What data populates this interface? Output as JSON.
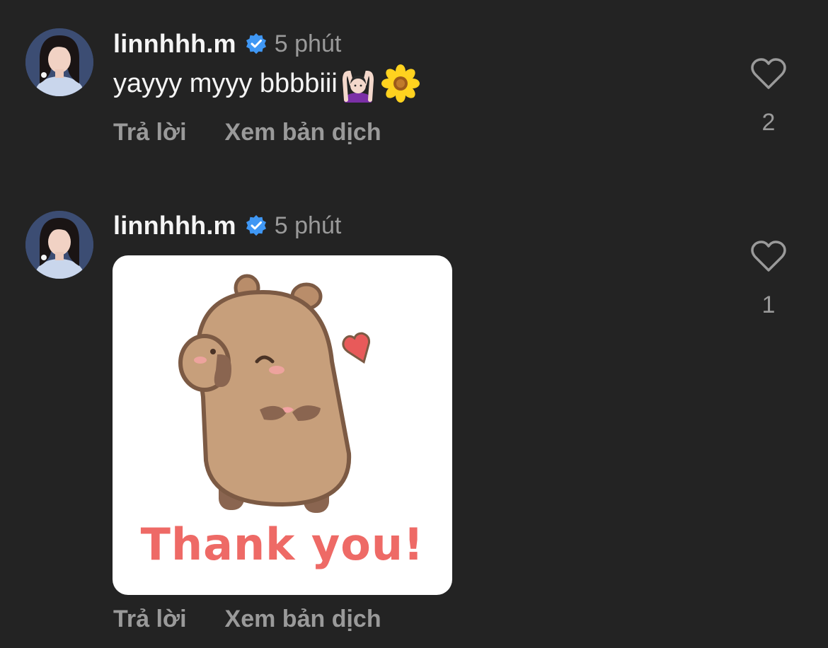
{
  "comments": [
    {
      "username": "linnhhh.m",
      "verified": true,
      "time": "5 phút",
      "text": "yayyy myyy bbbbiii",
      "emojis": [
        "person-gesturing-ok-icon",
        "sunflower-icon"
      ],
      "actions": {
        "reply": "Trả lời",
        "translate": "Xem bản dịch"
      },
      "likes": "2"
    },
    {
      "username": "linnhhh.m",
      "verified": true,
      "time": "5 phút",
      "sticker": {
        "caption": "Thank you!",
        "icon": "capybara-heart-sticker"
      },
      "actions": {
        "reply": "Trả lời",
        "translate": "Xem bản dịch"
      },
      "likes": "1"
    }
  ],
  "colors": {
    "background": "#232323",
    "primary_text": "#f5f5f5",
    "secondary_text": "#9a9a9a",
    "verified_badge": "#3f97f4",
    "sticker_caption": "#ee6a66"
  }
}
